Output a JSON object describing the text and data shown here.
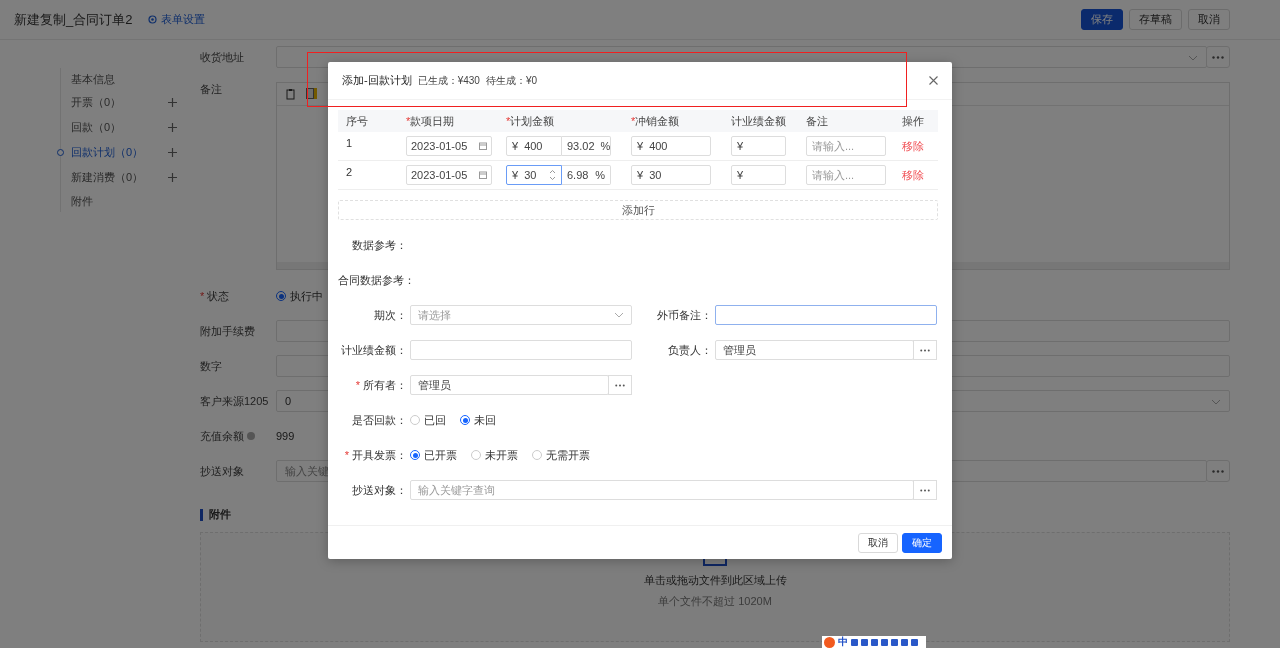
{
  "header": {
    "title": "新建复制_合同订单2",
    "settings_link": "表单设置",
    "buttons": [
      {
        "label": "保存",
        "kind": "primary"
      },
      {
        "label": "存草稿",
        "kind": "default"
      },
      {
        "label": "取消",
        "kind": "default"
      }
    ]
  },
  "sidebar": {
    "items": [
      {
        "label": "基本信息",
        "selected": false,
        "addable": false
      },
      {
        "label": "开票（0）",
        "selected": false,
        "addable": true
      },
      {
        "label": "回款（0）",
        "selected": false,
        "addable": true
      },
      {
        "label": "回款计划（0）",
        "selected": true,
        "addable": true
      },
      {
        "label": "新建消费（0）",
        "selected": false,
        "addable": true
      },
      {
        "label": "附件",
        "selected": false,
        "addable": false
      }
    ]
  },
  "form": {
    "rows": [
      {
        "label": "收货地址",
        "kind": "select_more"
      },
      {
        "label": "备注",
        "kind": "editor"
      },
      {
        "label": "状态",
        "kind": "radio",
        "required_mark": "*",
        "options": [
          {
            "label": "执行中",
            "selected": true
          }
        ]
      },
      {
        "label": "附加手续费",
        "kind": "input"
      },
      {
        "label": "数字",
        "kind": "input"
      },
      {
        "label": "客户来源1205",
        "kind": "select",
        "value": "0"
      },
      {
        "label": "充值余额",
        "kind": "text",
        "value": "999",
        "help": true
      },
      {
        "label": "抄送对象",
        "kind": "search_more",
        "placeholder": "输入关键"
      }
    ]
  },
  "attachments": {
    "title": "附件",
    "hint": "单击或拖动文件到此区域上传",
    "limit": "单个文件不超过 1020M"
  },
  "modal": {
    "title": "添加-回款计划",
    "generated": "已生成：¥430",
    "pending": "待生成：¥0",
    "columns": [
      {
        "label": "序号"
      },
      {
        "label": "款项日期",
        "required_mark": "*"
      },
      {
        "label": "计划金额",
        "required_mark": "*"
      },
      {
        "label": "冲销金额",
        "required_mark": "*"
      },
      {
        "label": "计业绩金额"
      },
      {
        "label": "备注"
      },
      {
        "label": "操作"
      }
    ],
    "rows": [
      {
        "index": "1",
        "date": "2023-01-05",
        "plan_prefix": "¥",
        "plan_amount": "400",
        "focused": false,
        "percent": "93.02",
        "percent_unit": "%",
        "offset_prefix": "¥",
        "offset_amount": "400",
        "perf_prefix": "¥",
        "note_placeholder": "请输入...",
        "action": "移除"
      },
      {
        "index": "2",
        "date": "2023-01-05",
        "plan_prefix": "¥",
        "plan_amount": "30",
        "focused": true,
        "percent": "6.98",
        "percent_unit": "%",
        "offset_prefix": "¥",
        "offset_amount": "30",
        "perf_prefix": "¥",
        "note_placeholder": "请输入...",
        "action": "移除"
      }
    ],
    "add_row": "添加行",
    "form_rows": [
      [
        {
          "label": "数据参考：",
          "kind": "reference"
        }
      ],
      [
        {
          "label": "合同数据参考：",
          "kind": "reference"
        }
      ],
      [
        {
          "label": "期次：",
          "kind": "select",
          "placeholder": "请选择"
        },
        {
          "label": "外币备注：",
          "kind": "input",
          "focused": true
        }
      ],
      [
        {
          "label": "计业绩金额：",
          "kind": "input",
          "focused": false
        },
        {
          "label": "负责人：",
          "kind": "more",
          "value": "管理员"
        }
      ],
      [
        {
          "label": "所有者：",
          "kind": "more",
          "required_mark": "*",
          "value": "管理员"
        }
      ],
      [
        {
          "label": "是否回款：",
          "kind": "radio",
          "options": [
            {
              "label": "已回",
              "selected": false
            },
            {
              "label": "未回",
              "selected": true
            }
          ]
        }
      ],
      [
        {
          "label": "开具发票：",
          "kind": "radio",
          "required_mark": "*",
          "options": [
            {
              "label": "已开票",
              "selected": true
            },
            {
              "label": "未开票",
              "selected": false
            },
            {
              "label": "无需开票",
              "selected": false
            }
          ]
        }
      ],
      [
        {
          "label": "抄送对象：",
          "kind": "more",
          "wide": true,
          "placeholder": "输入关键字查询"
        }
      ]
    ],
    "buttons": [
      {
        "label": "取消",
        "kind": "default"
      },
      {
        "label": "确定",
        "kind": "primary"
      }
    ]
  },
  "ime": {
    "label": "中"
  }
}
